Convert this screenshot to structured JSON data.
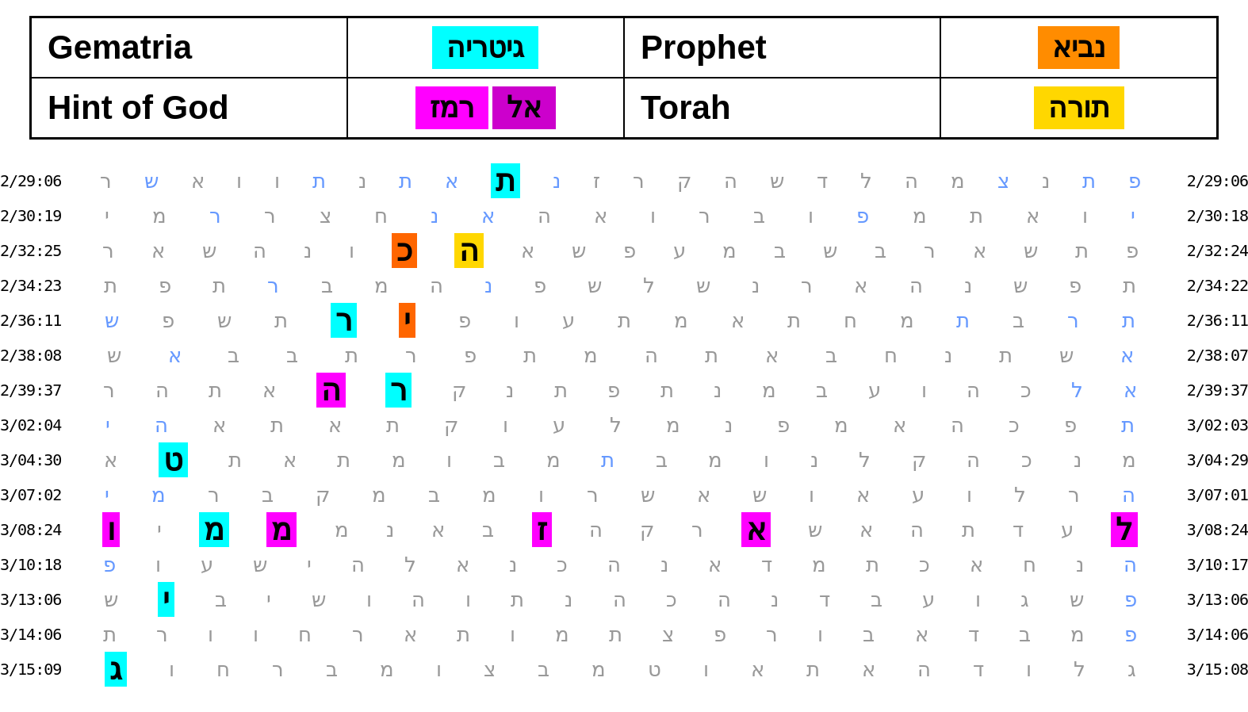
{
  "header": {
    "row1": {
      "label1": "Gematria",
      "value1": "גיטריה",
      "value1_color": "cyan",
      "label2": "Prophet",
      "value2": "נביא",
      "value2_color": "orange"
    },
    "row2": {
      "label1": "Hint of God",
      "value1a": "רמז",
      "value1b": "אל",
      "value1a_color": "magenta",
      "value1b_color": "magenta2",
      "label2": "Torah",
      "value2": "תורה",
      "value2_color": "yellow"
    }
  },
  "rows": [
    {
      "left_time": "2/29:06",
      "right_time": "2/29:06"
    },
    {
      "left_time": "2/30:19",
      "right_time": "2/30:18"
    },
    {
      "left_time": "2/32:25",
      "right_time": "2/32:24"
    },
    {
      "left_time": "2/34:23",
      "right_time": "2/34:22"
    },
    {
      "left_time": "2/36:11",
      "right_time": "2/36:11"
    },
    {
      "left_time": "2/38:08",
      "right_time": "2/38:07"
    },
    {
      "left_time": "2/39:37",
      "right_time": "2/39:37"
    },
    {
      "left_time": "3/02:04",
      "right_time": "3/02:03"
    },
    {
      "left_time": "3/04:30",
      "right_time": "3/04:29"
    },
    {
      "left_time": "3/07:02",
      "right_time": "3/07:01"
    },
    {
      "left_time": "3/08:24",
      "right_time": "3/08:24"
    },
    {
      "left_time": "3/10:18",
      "right_time": "3/10:17"
    },
    {
      "left_time": "3/13:06",
      "right_time": "3/13:06"
    },
    {
      "left_time": "3/14:06",
      "right_time": "3/14:06"
    },
    {
      "left_time": "3/15:09",
      "right_time": "3/15:08"
    }
  ]
}
